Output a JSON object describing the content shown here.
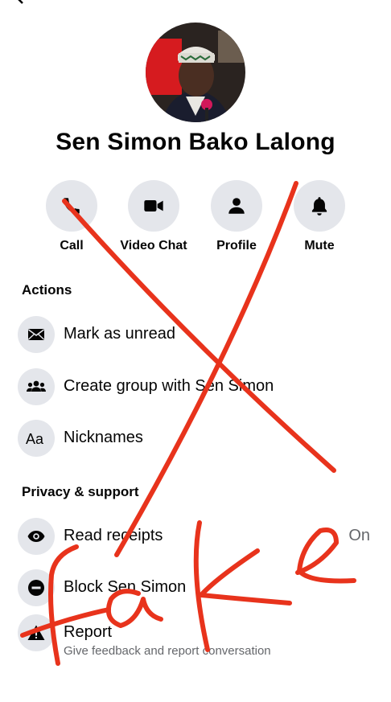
{
  "profile": {
    "name": "Sen Simon Bako Lalong"
  },
  "quick_actions": [
    {
      "label": "Call",
      "icon": "phone-icon"
    },
    {
      "label": "Video Chat",
      "icon": "video-camera-icon"
    },
    {
      "label": "Profile",
      "icon": "person-icon"
    },
    {
      "label": "Mute",
      "icon": "bell-icon"
    }
  ],
  "actions_section": {
    "title": "Actions",
    "items": [
      {
        "label": "Mark as unread",
        "icon": "envelope-icon"
      },
      {
        "label": "Create group with Sen Simon",
        "icon": "group-icon"
      },
      {
        "label": "Nicknames",
        "icon": "aa-text-icon"
      }
    ]
  },
  "privacy_section": {
    "title": "Privacy & support",
    "read_receipts": {
      "label": "Read receipts",
      "value": "On",
      "icon": "eye-icon"
    },
    "block": {
      "label": "Block Sen Simon",
      "icon": "block-icon"
    },
    "report": {
      "label": "Report",
      "sublabel": "Give feedback and report conversation",
      "icon": "warning-icon"
    }
  },
  "overlay": {
    "text": "fake",
    "color": "#e8331c"
  },
  "colors": {
    "icon_bg": "#e4e6eb",
    "secondary_text": "#65676b"
  }
}
